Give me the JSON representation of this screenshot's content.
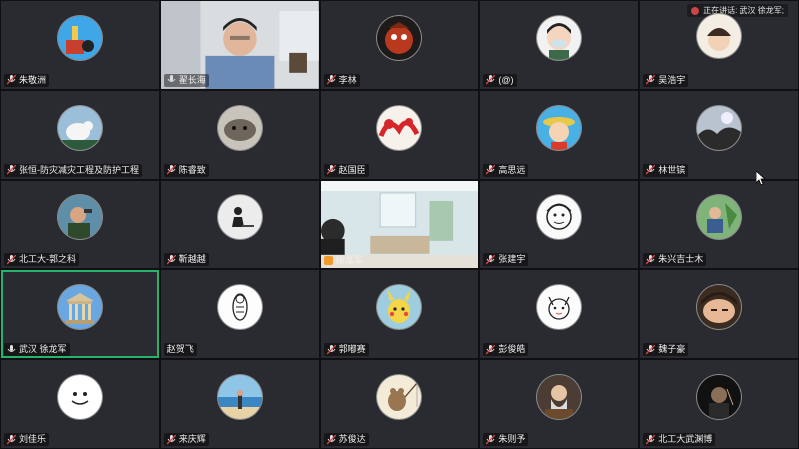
{
  "speaking": {
    "text": "正在讲话: 武汉 徐龙军;"
  },
  "colors": {
    "tile_bg": "#2a2b30",
    "active_border": "#27b36a",
    "mic_muted": "#e04848",
    "name_text": "#f0f0f0"
  },
  "participants": [
    {
      "name": "朱敬洲",
      "avatar": "cartoon-shooter"
    },
    {
      "name": "翟长海",
      "avatar": "video-man"
    },
    {
      "name": "李林",
      "avatar": "red-character"
    },
    {
      "name": "(@)",
      "avatar": "masked-boy"
    },
    {
      "name": "吴浩宇",
      "avatar": "cartoon-character"
    },
    {
      "name": "张恒-防灾减灾工程及防护工程",
      "avatar": "white-bird"
    },
    {
      "name": "陈睿致",
      "avatar": "seal-animal"
    },
    {
      "name": "赵国臣",
      "avatar": "red-chinese-art"
    },
    {
      "name": "高思远",
      "avatar": "straw-hat-pirate"
    },
    {
      "name": "林世镔",
      "avatar": "sky-tree"
    },
    {
      "name": "北工大-郭之科",
      "avatar": "man-with-drink"
    },
    {
      "name": "靳越越",
      "avatar": "sitting-silhouette"
    },
    {
      "name": "徐龙军",
      "avatar": "video-living-room"
    },
    {
      "name": "张建宇",
      "avatar": "line-drawing-face"
    },
    {
      "name": "朱兴吉士木",
      "avatar": "nature-person"
    },
    {
      "name": "武汉 徐龙军",
      "avatar": "greek-temple"
    },
    {
      "name": "赵贺飞",
      "avatar": "astronaut-sketch"
    },
    {
      "name": "郭嘟赛",
      "avatar": "pikachu"
    },
    {
      "name": "彭俊皓",
      "avatar": "cat-sketch"
    },
    {
      "name": "魏子豪",
      "avatar": "face-closeup"
    },
    {
      "name": "刘佳乐",
      "avatar": "smiley-face"
    },
    {
      "name": "来庆辉",
      "avatar": "beach-person"
    },
    {
      "name": "苏俊达",
      "avatar": "bear-fishing"
    },
    {
      "name": "朱则予",
      "avatar": "old-man"
    },
    {
      "name": "北工大武渊博",
      "avatar": "dark-portrait"
    }
  ]
}
